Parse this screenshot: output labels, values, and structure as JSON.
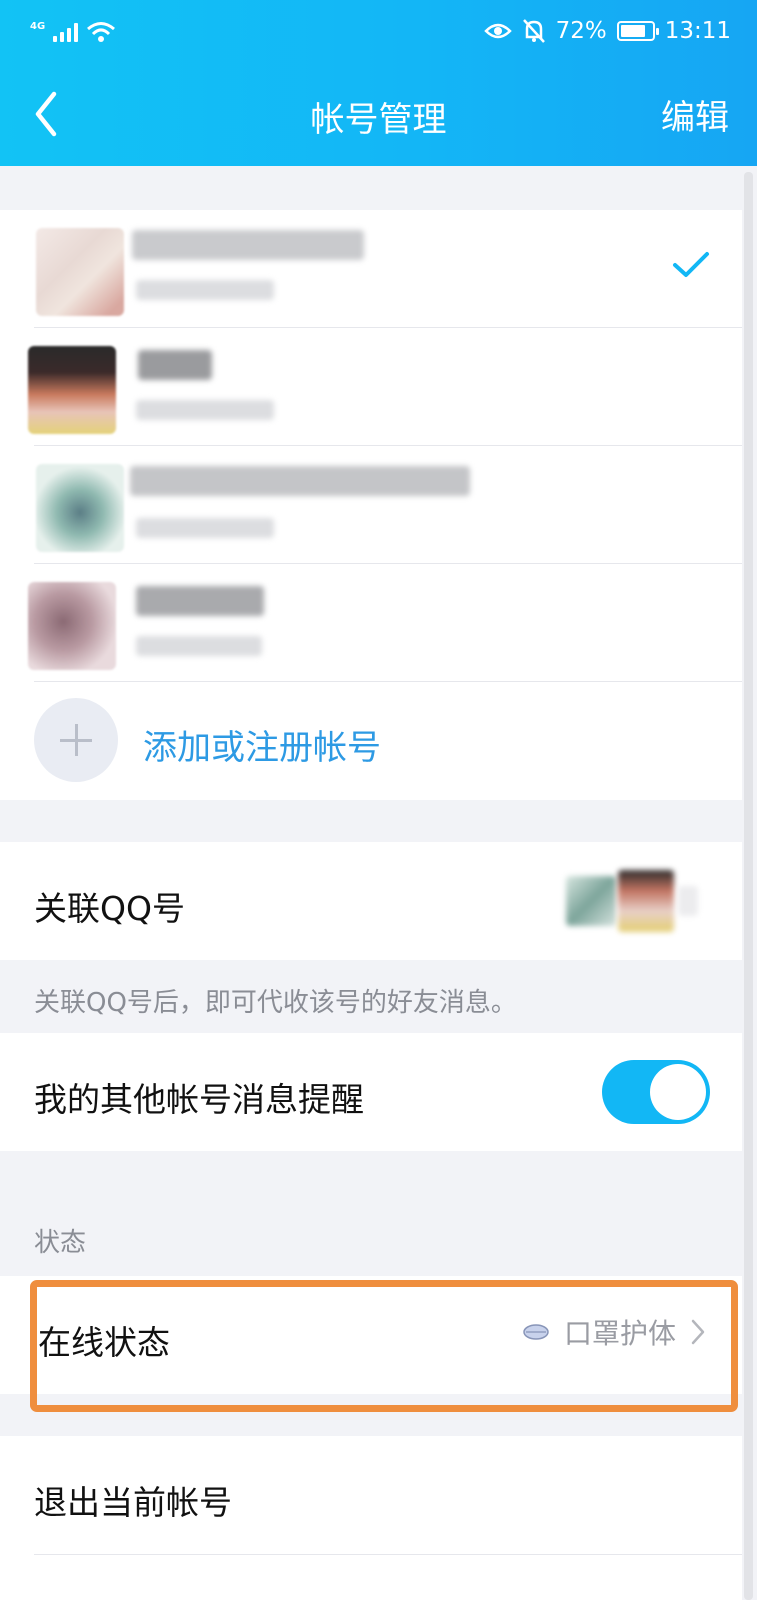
{
  "status_bar": {
    "network": "4G",
    "battery": "72%",
    "time": "13:11"
  },
  "nav": {
    "title": "帐号管理",
    "edit_label": "编辑"
  },
  "accounts": {
    "add_label": "添加或注册帐号"
  },
  "linked_qq": {
    "label": "关联QQ号",
    "hint": "关联QQ号后，即可代收该号的好友消息。"
  },
  "reminder": {
    "label": "我的其他帐号消息提醒",
    "enabled": true
  },
  "status_section": {
    "title": "状态",
    "online_label": "在线状态",
    "online_value": "口罩护体"
  },
  "logout": {
    "label": "退出当前帐号"
  },
  "colors": {
    "header": "#12c3f5",
    "accent": "#2d9ae4",
    "toggle_on": "#12b7f5",
    "highlight": "#ef8e3e"
  }
}
